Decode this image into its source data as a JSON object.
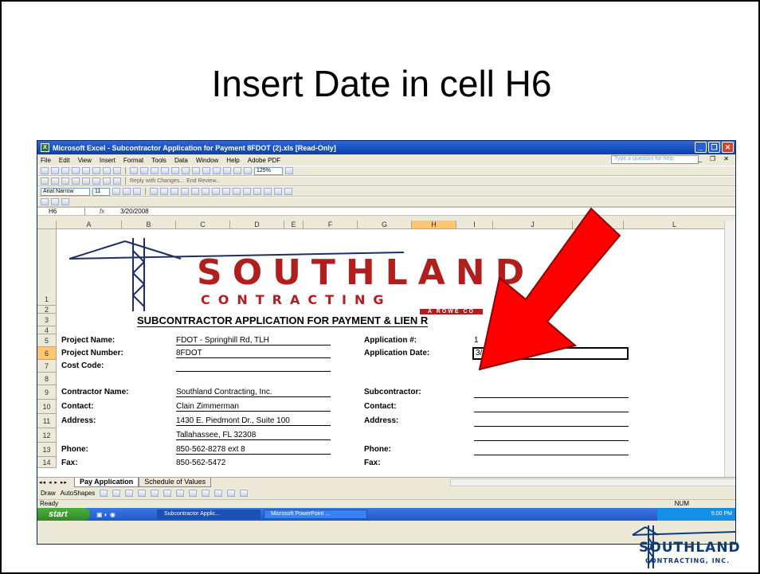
{
  "slide": {
    "title": "Insert Date in cell H6"
  },
  "excel": {
    "window_title": "Microsoft Excel - Subcontractor Application for Payment 8FDOT (2).xls [Read-Only]",
    "menus": [
      "File",
      "Edit",
      "View",
      "Insert",
      "Format",
      "Tools",
      "Data",
      "Window",
      "Help",
      "Adobe PDF"
    ],
    "help_placeholder": "Type a question for help",
    "zoom": "125%",
    "font_name": "Arial Narrow",
    "font_size": "11",
    "reply_label": "Reply with Changes...",
    "end_review_label": "End Review...",
    "name_box": "H6",
    "fx": "fx",
    "formula_value": "3/20/2008",
    "columns": [
      "A",
      "B",
      "C",
      "D",
      "E",
      "F",
      "G",
      "H",
      "I",
      "J",
      "K",
      "L"
    ],
    "selected_column": "H",
    "rows": [
      "1",
      "2",
      "3",
      "4",
      "5",
      "6",
      "7",
      "8",
      "9",
      "10",
      "11",
      "12",
      "13",
      "14"
    ],
    "selected_row": "6",
    "logo": {
      "word": "SOUTHLAND",
      "sub": "CONTRACTING",
      "tag": "A ROWE CO"
    },
    "heading": "SUBCONTRACTOR APPLICATION FOR PAYMENT & LIEN R",
    "cells": {
      "r5a": "Project Name:",
      "r5b": "FDOT - Springhill Rd, TLH",
      "r5f": "Application #:",
      "r5h": "1",
      "r6a": "Project Number:",
      "r6b": "8FDOT",
      "r6f": "Application Date:",
      "r6h": "3/20/2008",
      "r7a": "Cost Code:",
      "r9a": "Contractor Name:",
      "r9b": "Southland Contracting, Inc.",
      "r9f": "Subcontractor:",
      "r10a": "Contact:",
      "r10b": "Clain Zimmerman",
      "r10f": "Contact:",
      "r11a": "Address:",
      "r11b": "1430 E. Piedmont Dr., Suite 100",
      "r11f": "Address:",
      "r12b": "Tallahassee, FL 32308",
      "r13a": "Phone:",
      "r13b": "850-562-8278 ext 8",
      "r13f": "Phone:",
      "r14a": "Fax:",
      "r14b": "850-562-5472",
      "r14f": "Fax:"
    },
    "tabs": [
      "Pay Application",
      "Schedule of Values"
    ],
    "draw_label": "Draw",
    "autoshapes_label": "AutoShapes",
    "status": "Ready",
    "status_num": "NUM",
    "taskbar": {
      "start": "start",
      "tasks": [
        "Subcontractor Applic...",
        "Microsoft PowerPoint ..."
      ],
      "time": "5:00 PM"
    }
  },
  "corner_logo": {
    "word": "SOUTHLAND",
    "sub": "CONTRACTING, INC."
  },
  "colors": {
    "arrow": "#ff0000",
    "logo_red": "#b01e1e",
    "selection": "#ffc66f"
  }
}
